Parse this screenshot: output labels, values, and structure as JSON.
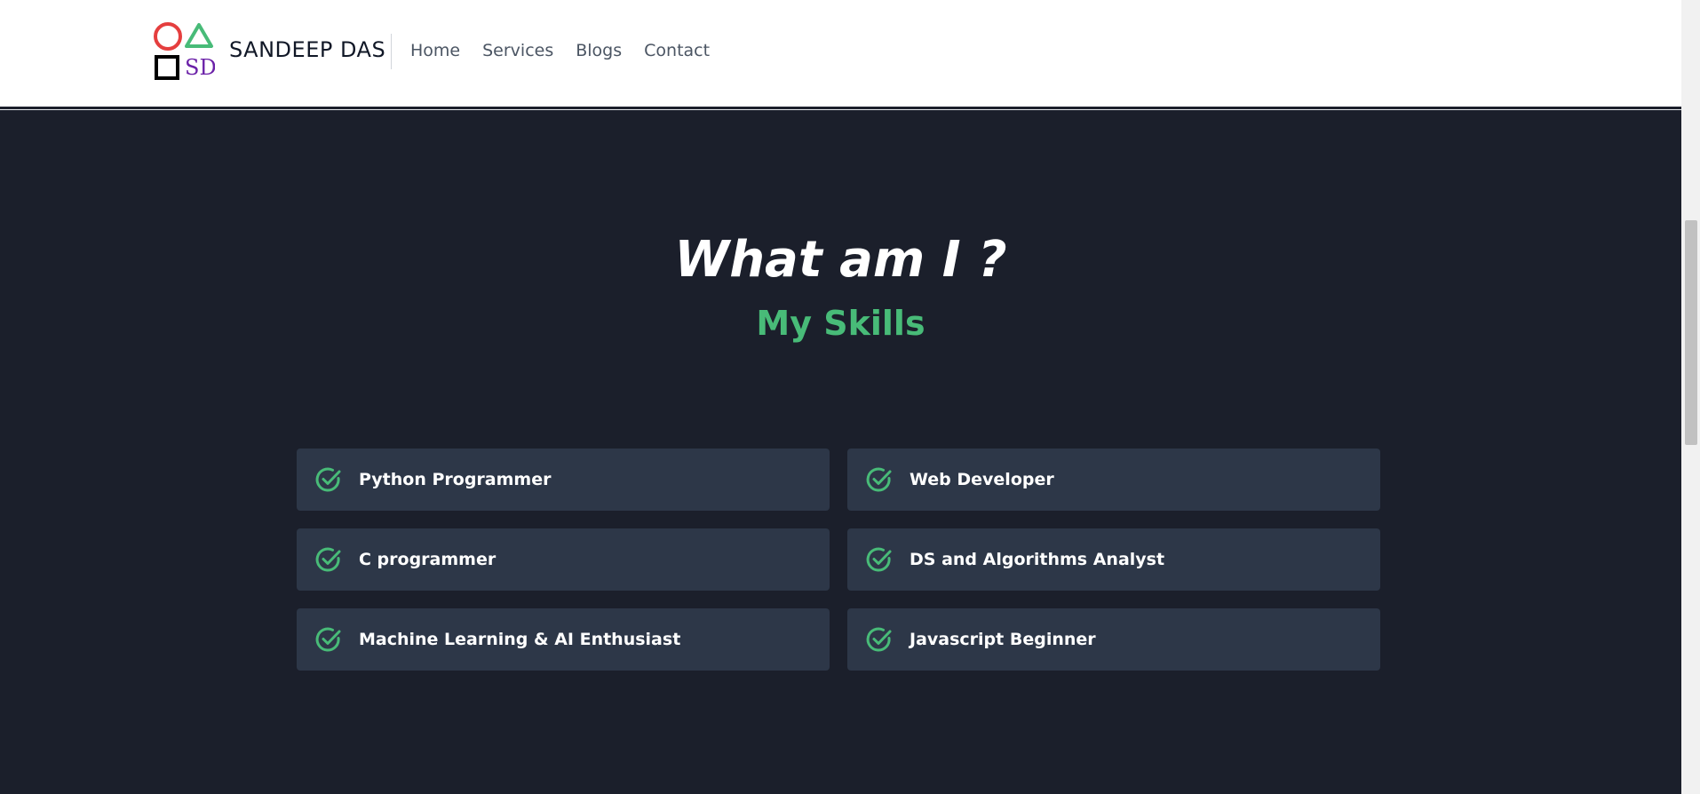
{
  "header": {
    "logo_text": "SD",
    "brand": "SANDEEP DAS",
    "nav": [
      "Home",
      "Services",
      "Blogs",
      "Contact"
    ]
  },
  "section": {
    "title": "What am I ?",
    "subtitle": "My Skills"
  },
  "skills": [
    {
      "label": "Python Programmer",
      "icon": "check-circle-icon"
    },
    {
      "label": "Web Developer",
      "icon": "check-circle-icon"
    },
    {
      "label": "C programmer",
      "icon": "check-circle-icon"
    },
    {
      "label": "DS and Algorithms Analyst",
      "icon": "check-circle-icon"
    },
    {
      "label": "Machine Learning & AI Enthusiast",
      "icon": "check-circle-icon"
    },
    {
      "label": "Javascript Beginner",
      "icon": "check-circle-icon"
    }
  ],
  "colors": {
    "accent": "#48bb78",
    "background": "#1b1f2b",
    "card": "#2d3748",
    "logo_circle": "#e53e3e",
    "logo_triangle": "#48bb78",
    "logo_text": "#6b21a8"
  }
}
